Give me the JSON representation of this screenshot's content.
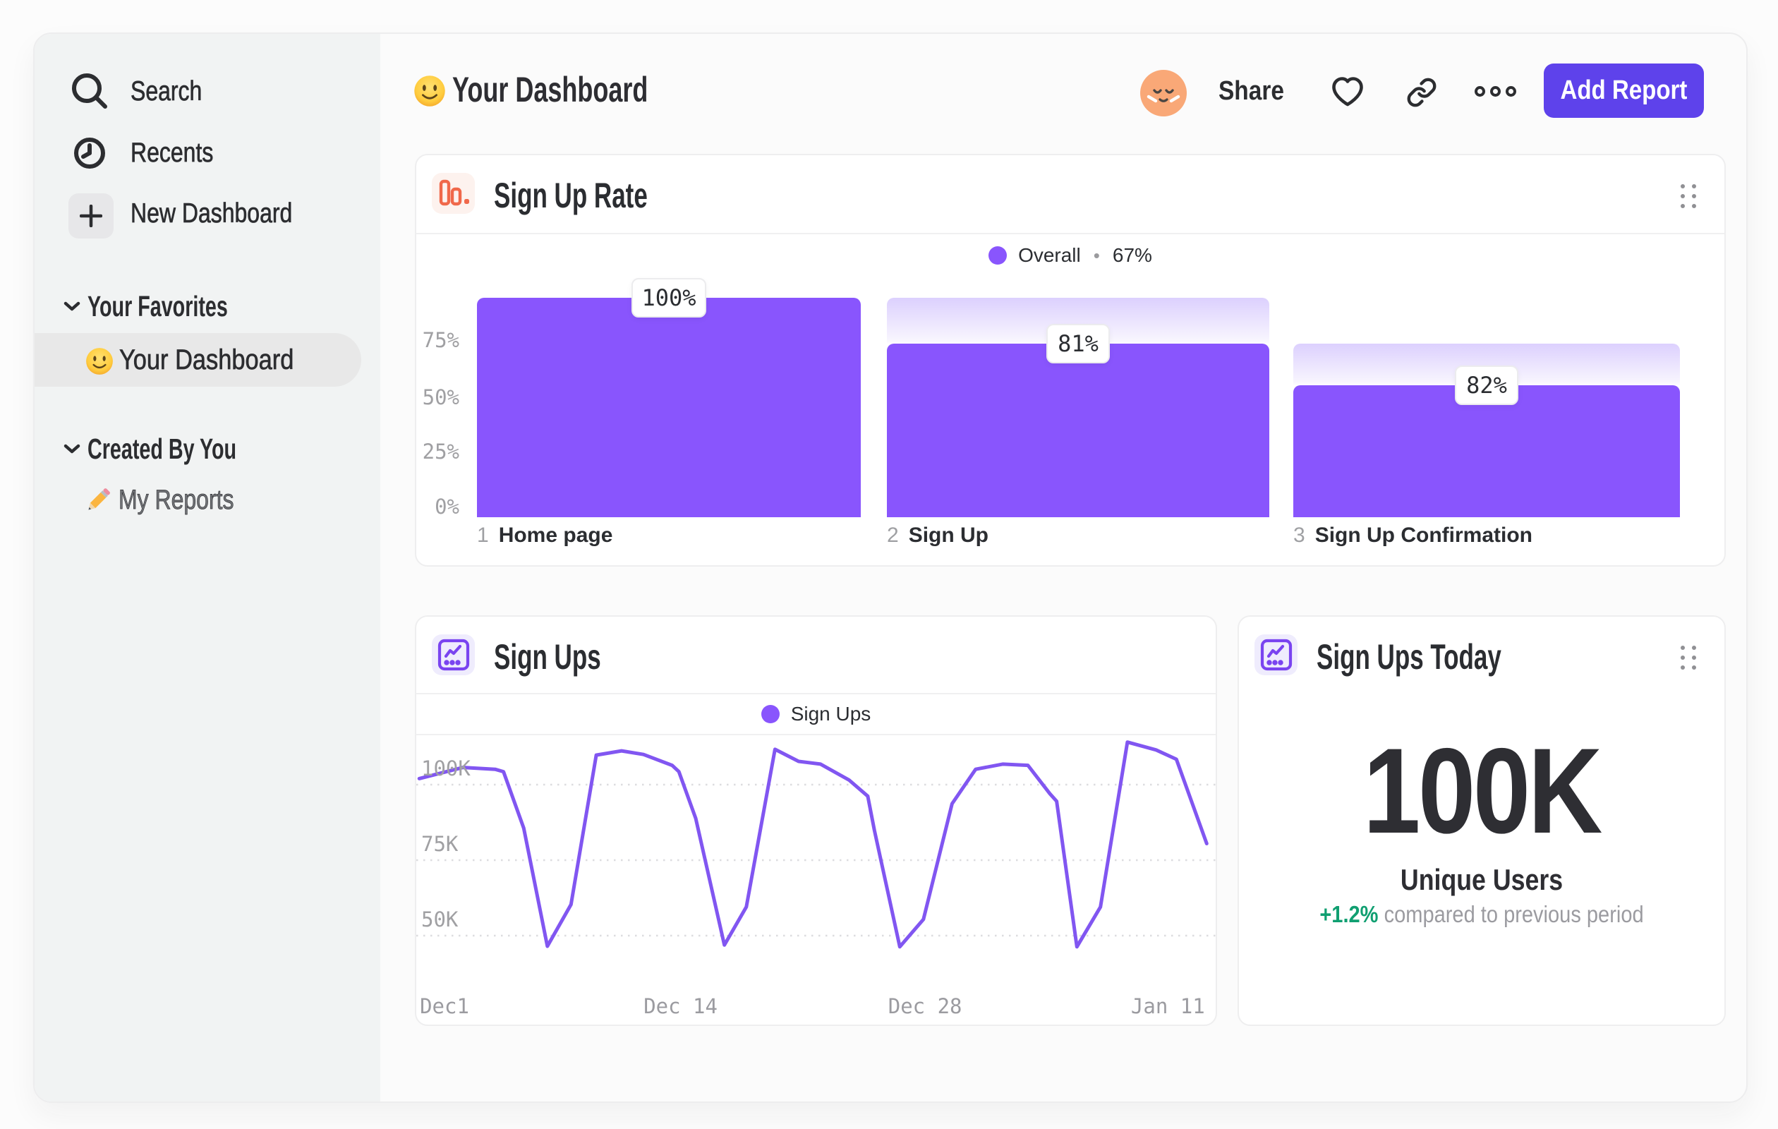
{
  "colors": {
    "accent_button": "#5e42eb",
    "bar_purple": "#8955fd",
    "line_purple": "#8156f1",
    "green": "#109f71",
    "orange_icon": "#f0684a",
    "icon_purple": "#7a44f0"
  },
  "sidebar": {
    "items": [
      {
        "label": "Search",
        "icon": "search-icon"
      },
      {
        "label": "Recents",
        "icon": "clock-icon"
      },
      {
        "label": "New Dashboard",
        "icon": "plus-icon"
      }
    ],
    "sections": [
      {
        "title": "Your Favorites",
        "items": [
          {
            "label": "Your Dashboard",
            "emoji": "smiley",
            "selected": true
          }
        ]
      },
      {
        "title": "Created By You",
        "items": [
          {
            "label": "My Reports",
            "emoji": "pencil",
            "selected": false
          }
        ]
      }
    ]
  },
  "header": {
    "emoji": "smiley",
    "title": "Your Dashboard",
    "share_label": "Share",
    "add_report_label": "Add Report"
  },
  "chart_data": [
    {
      "id": "signup_rate",
      "type": "funnel",
      "title": "Sign Up Rate",
      "legend_series": "Overall",
      "legend_sep": "•",
      "legend_value": "67%",
      "y_ticks": [
        "75%",
        "50%",
        "25%",
        "0%"
      ],
      "steps": [
        {
          "index": "1",
          "name": "Home page",
          "rate": "100%",
          "height_frac": 1.0,
          "ghost_from_frac": null
        },
        {
          "index": "2",
          "name": "Sign Up",
          "rate": "81%",
          "height_frac": 0.791,
          "ghost_from_frac": 1.0
        },
        {
          "index": "3",
          "name": "Sign Up Confirmation",
          "rate": "82%",
          "height_frac": 0.601,
          "ghost_from_frac": 0.791
        }
      ]
    },
    {
      "id": "signups",
      "type": "line",
      "title": "Sign Ups",
      "legend_series": "Sign Ups",
      "y_ticks": [
        {
          "label": "100K",
          "value": 100
        },
        {
          "label": "75K",
          "value": 75
        },
        {
          "label": "50K",
          "value": 50
        }
      ],
      "x_ticks": [
        {
          "label": "Dec1",
          "day": 0
        },
        {
          "label": "Dec 14",
          "day": 14
        },
        {
          "label": "Dec 28",
          "day": 28.5
        },
        {
          "label": "Jan 11",
          "day": 42.9
        }
      ],
      "unit": "K",
      "points": [
        [
          -1.5,
          102
        ],
        [
          1.1,
          105.7
        ],
        [
          3.0,
          105.1
        ],
        [
          3.5,
          104.3
        ],
        [
          4.7,
          85.6
        ],
        [
          6.1,
          46.5
        ],
        [
          7.5,
          60.3
        ],
        [
          9.0,
          109.8
        ],
        [
          10.5,
          111.2
        ],
        [
          11.8,
          110.0
        ],
        [
          13.5,
          106.4
        ],
        [
          13.9,
          104.3
        ],
        [
          14.9,
          88.8
        ],
        [
          16.6,
          46.9
        ],
        [
          17.9,
          59.5
        ],
        [
          19.6,
          111.7
        ],
        [
          21.0,
          107.7
        ],
        [
          22.3,
          106.8
        ],
        [
          24.0,
          101.5
        ],
        [
          25.1,
          96.2
        ],
        [
          25.5,
          84.8
        ],
        [
          27.0,
          46.3
        ],
        [
          28.4,
          55.4
        ],
        [
          30.1,
          93.7
        ],
        [
          31.5,
          105.1
        ],
        [
          33.1,
          106.8
        ],
        [
          34.6,
          106.4
        ],
        [
          35.9,
          97.0
        ],
        [
          36.3,
          94.5
        ],
        [
          37.5,
          46.3
        ],
        [
          38.9,
          59.5
        ],
        [
          40.5,
          114.1
        ],
        [
          42.2,
          111.5
        ],
        [
          43.4,
          108.4
        ],
        [
          45.2,
          80.5
        ]
      ]
    },
    {
      "id": "signups_today",
      "type": "metric",
      "title": "Sign Ups Today",
      "value": "100K",
      "value_label": "Unique Users",
      "delta": "+1.2%",
      "delta_note": "compared to previous period"
    }
  ]
}
